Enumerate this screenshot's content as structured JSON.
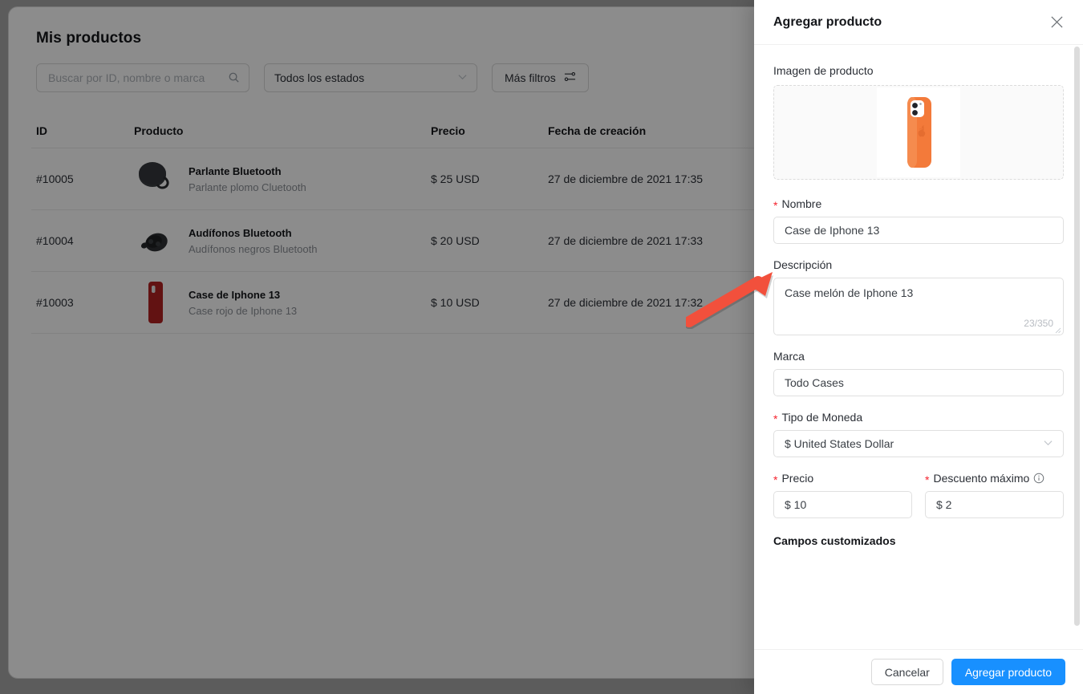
{
  "page": {
    "title": "Mis productos"
  },
  "filters": {
    "search_placeholder": "Buscar por ID, nombre o marca",
    "search_value": "",
    "search_icon": "search-icon",
    "status_select": "Todos los estados",
    "status_chevron": "chevron-down-icon",
    "more_filters_label": "Más filtros",
    "more_filters_icon": "sliders-icon"
  },
  "table": {
    "columns": [
      "ID",
      "Producto",
      "Precio",
      "Fecha de creación"
    ],
    "rows": [
      {
        "id": "#10005",
        "name": "Parlante Bluetooth",
        "desc": "Parlante plomo Cluetooth",
        "price": "$ 25 USD",
        "date": "27 de diciembre de 2021 17:35",
        "thumb": "speaker-thumbnail"
      },
      {
        "id": "#10004",
        "name": "Audífonos Bluetooth",
        "desc": "Audífonos negros Bluetooth",
        "price": "$ 20 USD",
        "date": "27 de diciembre de 2021 17:33",
        "thumb": "earbuds-thumbnail"
      },
      {
        "id": "#10003",
        "name": "Case de Iphone 13",
        "desc": "Case rojo de Iphone 13",
        "price": "$ 10 USD",
        "date": "27 de diciembre de 2021 17:32",
        "thumb": "phone-case-thumbnail"
      }
    ]
  },
  "drawer": {
    "title": "Agregar producto",
    "close_icon": "close-icon",
    "image_section": {
      "label": "Imagen de producto",
      "image_alt": "iphone-case-orange-image"
    },
    "fields": {
      "nombre": {
        "label": "Nombre",
        "required": true,
        "value": "Case de Iphone 13"
      },
      "descripcion": {
        "label": "Descripción",
        "required": false,
        "value": "Case melón de Iphone 13",
        "counter": "23/350"
      },
      "marca": {
        "label": "Marca",
        "required": false,
        "value": "Todo Cases"
      },
      "moneda": {
        "label": "Tipo de Moneda",
        "required": true,
        "value": "$ United States Dollar",
        "chevron": "chevron-down-icon"
      },
      "precio": {
        "label": "Precio",
        "required": true,
        "value": "$ 10"
      },
      "descuento": {
        "label": "Descuento máximo",
        "required": true,
        "value": "$ 2",
        "info_icon": "info-circle-icon"
      }
    },
    "custom_fields_title": "Campos customizados",
    "footer": {
      "cancel_label": "Cancelar",
      "submit_label": "Agregar producto"
    }
  },
  "annotation": {
    "arrow": "red-arrow-pointing-to-nombre-field",
    "color": "#f2503c"
  },
  "colors": {
    "primary": "#1890ff",
    "required_asterisk": "#f5222d",
    "overlay": "rgba(0,0,0,0.45)",
    "case_orange": "#f37a3a"
  }
}
